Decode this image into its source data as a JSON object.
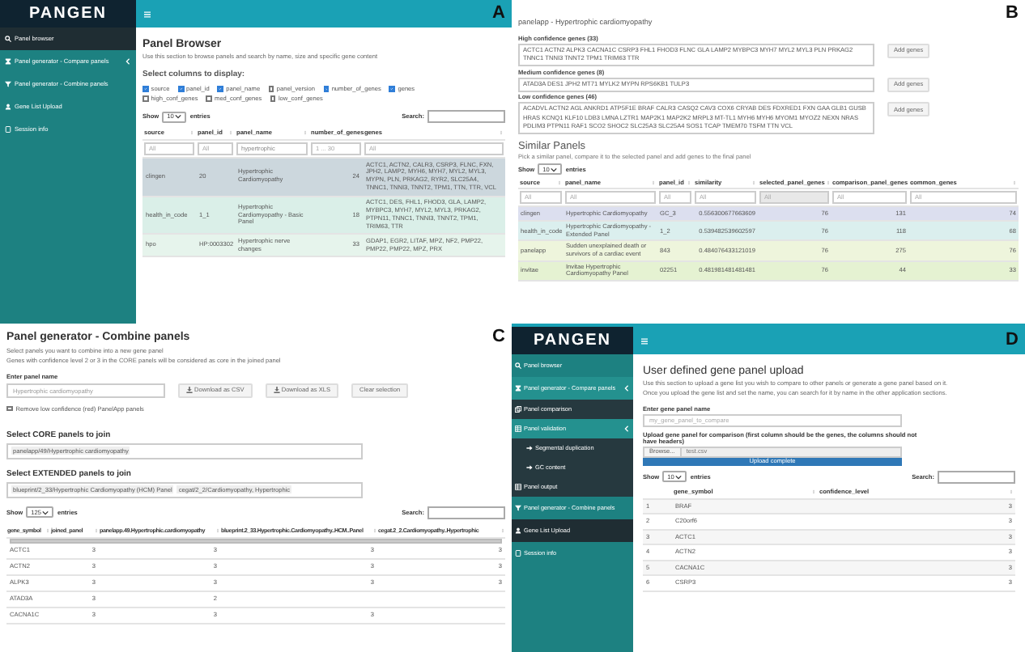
{
  "panel_a": {
    "label": "A",
    "logo": "PANGEN",
    "sidebar": {
      "items": [
        {
          "label": "Panel browser",
          "selected": true
        },
        {
          "label": "Panel generator - Compare panels",
          "selected": false,
          "expanded": false
        },
        {
          "label": "Panel generator - Combine panels",
          "selected": false
        },
        {
          "label": "Gene List Upload",
          "selected": false
        },
        {
          "label": "Session info",
          "selected": false
        }
      ]
    },
    "title": "Panel Browser",
    "description": "Use this section to browse panels and search by name, size and specific gene content",
    "columns_heading": "Select columns to display:",
    "column_options": [
      {
        "label": "source",
        "checked": true
      },
      {
        "label": "panel_id",
        "checked": true
      },
      {
        "label": "panel_name",
        "checked": true
      },
      {
        "label": "panel_version",
        "checked": false
      },
      {
        "label": "number_of_genes",
        "checked": true
      },
      {
        "label": "genes",
        "checked": true
      },
      {
        "label": "high_conf_genes",
        "checked": false
      },
      {
        "label": "med_conf_genes",
        "checked": false
      },
      {
        "label": "low_conf_genes",
        "checked": false
      }
    ],
    "show_label": "Show",
    "entries_select": "10",
    "entries_label": "entries",
    "search_label": "Search:",
    "table": {
      "columns": [
        "source",
        "panel_id",
        "panel_name",
        "number_of_genes",
        "genes"
      ],
      "filters": [
        {
          "placeholder": "All"
        },
        {
          "placeholder": "All"
        },
        {
          "value": "hypertrophic"
        },
        {
          "placeholder": "1 ... 30"
        },
        {
          "placeholder": "All"
        }
      ],
      "rows": [
        {
          "color": "#ccd7dd",
          "cells": [
            "clingen",
            "20",
            "Hypertrophic Cardiomyopathy",
            "24",
            "ACTC1, ACTN2, CALR3, CSRP3, FLNC, FXN, JPH2, LAMP2, MYH6, MYH7, MYL2, MYL3, MYPN, PLN, PRKAG2, RYR2, SLC25A4, TNNC1, TNNI3, TNNT2, TPM1, TTN, TTR, VCL"
          ]
        },
        {
          "color": "#daefe8",
          "cells": [
            "health_in_code",
            "1_1",
            "Hypertrophic Cardiomyopathy - Basic Panel",
            "18",
            "ACTC1, DES, FHL1, FHOD3, GLA, LAMP2, MYBPC3, MYH7, MYL2, MYL3, PRKAG2, PTPN11, TNNC1, TNNI3, TNNT2, TPM1, TRIM63, TTR"
          ]
        },
        {
          "color": "#e6f4ec",
          "cells": [
            "hpo",
            "HP:0003302",
            "Hypertrophic nerve changes",
            "33",
            "GDAP1, EGR2, LITAF, MPZ, NF2, PMP22, PMP22, PMP22, MPZ, PRX"
          ]
        }
      ]
    }
  },
  "panel_b": {
    "label": "B",
    "panel_title": "panelapp - Hypertrophic cardiomyopathy",
    "gene_groups": [
      {
        "heading": "High confidence genes (33)",
        "genes": "ACTC1 ACTN2 ALPK3 CACNA1C CSRP3 FHL1 FHOD3 FLNC GLA LAMP2 MYBPC3 MYH7 MYL2 MYL3 PLN PRKAG2 TNNC1 TNNI3 TNNT2 TPM1 TRIM63 TTR",
        "button": "Add genes"
      },
      {
        "heading": "Medium confidence genes (8)",
        "genes": "ATAD3A DES1 JPH2 MT71 MYLK2 MYPN RPS6KB1 TULP3",
        "button": "Add genes"
      },
      {
        "heading": "Low confidence genes (46)",
        "genes": "ACADVL ACTN2 AGL ANKRD1 ATP5F1E BRAF CALR3 CASQ2 CAV3 COX6 CRYAB DES FDXRED1 FXN GAA GLB1 GUSB HRAS KCNQ1 KLF10 LDB3 LMNA LZTR1 MAP2K1 MAP2K2 MRPL3 MT-TL1 MYH6 MYH6 MYOM1 MYOZ2 NEXN NRAS PDLIM3 PTPN11 RAF1 SCO2 SHOC2 SLC25A3 SLC25A4 SOS1 TCAP TMEM70 TSFM TTN VCL",
        "button": "Add genes"
      }
    ],
    "similar_title": "Similar Panels",
    "similar_description": "Pick a similar panel, compare it to the selected panel and add genes to the final panel",
    "show_label": "Show",
    "entries_select": "10",
    "entries_label": "entries",
    "table": {
      "columns": [
        "source",
        "panel_name",
        "panel_id",
        "similarity",
        "selected_panel_genes",
        "comparison_panel_genes",
        "common_genes"
      ],
      "filters": [
        {
          "placeholder": "All",
          "disabled": false
        },
        {
          "placeholder": "All",
          "disabled": false
        },
        {
          "placeholder": "All",
          "disabled": false
        },
        {
          "placeholder": "All",
          "disabled": false
        },
        {
          "placeholder": "All",
          "disabled": true
        },
        {
          "placeholder": "All",
          "disabled": false
        },
        {
          "placeholder": "All",
          "disabled": false
        }
      ],
      "rows": [
        {
          "color": "#dcdfef",
          "cells": [
            "clingen",
            "Hypertrophic Cardiomyopathy",
            "GC_3",
            "0.556300677663609",
            "76",
            "131",
            "74"
          ]
        },
        {
          "color": "#dbefee",
          "cells": [
            "health_in_code",
            "Hypertrophic Cardiomyopathy - Extended Panel",
            "1_2",
            "0.539482539602597",
            "76",
            "118",
            "68"
          ]
        },
        {
          "color": "#eef5dc",
          "cells": [
            "panelapp",
            "Sudden unexplained death or survivors of a cardiac event",
            "843",
            "0.484076433121019",
            "76",
            "275",
            "76"
          ]
        },
        {
          "color": "#e5f2d2",
          "cells": [
            "invitae",
            "Invitae Hypertrophic Cardiomyopathy Panel",
            "02251",
            "0.481981481481481",
            "76",
            "44",
            "33"
          ]
        }
      ]
    }
  },
  "panel_c": {
    "label": "C",
    "title": "Panel generator - Combine panels",
    "descriptions": [
      "Select panels you want to combine into a new gene panel",
      "Genes with confidence level 2 or 3 in the CORE panels will be considered as core in the joined panel"
    ],
    "name_label": "Enter panel name",
    "name_field": {
      "value": "Hypertrophic cardiomyopathy"
    },
    "buttons": [
      {
        "label": "Download as CSV",
        "kind": "download"
      },
      {
        "label": "Download as XLS",
        "kind": "download"
      },
      {
        "label": "Clear selection",
        "kind": "plain"
      }
    ],
    "remove_low": {
      "label": "Remove low confidence (red) PanelApp panels",
      "checked": false
    },
    "core_heading": "Select CORE panels to join",
    "core_panels": [
      "panelapp/49/Hypertrophic cardiomyopathy"
    ],
    "extended_heading": "Select EXTENDED panels to join",
    "extended_panels": [
      "blueprint/2_33/Hypertrophic Cardiomyopathy (HCM) Panel",
      "cegat/2_2/Cardiomyopathy, Hypertrophic"
    ],
    "show_label": "Show",
    "entries_select": "125",
    "entries_label": "entries",
    "search_label": "Search:",
    "table": {
      "columns": [
        "gene_symbol",
        "joined_panel",
        "panelapp.49.Hypertrophic.cardiomyopathy",
        "blueprint.2_33.Hypertrophic.Cardiomyopathy..HCM..Panel",
        "cegat.2_2.Cardiomyopathy..Hypertrophic"
      ],
      "rows": [
        [
          "ACTC1",
          "3",
          "3",
          "3",
          "3"
        ],
        [
          "ACTN2",
          "3",
          "3",
          "3",
          "3"
        ],
        [
          "ALPK3",
          "3",
          "3",
          "3",
          "3"
        ],
        [
          "ATAD3A",
          "3",
          "2",
          null,
          null
        ],
        [
          "CACNA1C",
          "3",
          "3",
          "3",
          null
        ]
      ]
    }
  },
  "panel_d": {
    "label": "D",
    "logo": "PANGEN",
    "sidebar": {
      "items": [
        {
          "label": "Panel browser",
          "selected": false
        },
        {
          "label": "Panel generator - Compare panels",
          "selected": false,
          "expanded": true,
          "children": [
            {
              "label": "Panel comparison",
              "selected": false
            },
            {
              "label": "Panel validation",
              "selected": false,
              "expanded": true,
              "children": [
                {
                  "label": "Segmental duplication",
                  "selected": false
                },
                {
                  "label": "GC content",
                  "selected": false
                }
              ]
            },
            {
              "label": "Panel output",
              "selected": false
            }
          ]
        },
        {
          "label": "Panel generator - Combine panels",
          "selected": false
        },
        {
          "label": "Gene List Upload",
          "selected": true
        },
        {
          "label": "Session info",
          "selected": false
        }
      ]
    },
    "title": "User defined gene panel upload",
    "descriptions": [
      "Use this section to upload a gene list you wish to compare to other panels or generate a gene panel based on it.",
      "Once you upload the gene list and set the name, you can search for it by name in the other application sections."
    ],
    "name_label": "Enter gene panel name",
    "name_field": {
      "placeholder": "my_gene_panel_to_compare"
    },
    "upload_label": "Upload gene panel for comparison (first column should be the genes, the columns should not have headers)",
    "browse_button": "Browse...",
    "file_name": "test.csv",
    "upload_progress": {
      "level": 1,
      "label": "Upload complete"
    },
    "show_label": "Show",
    "entries_select": "10",
    "entries_label": "entries",
    "search_label": "Search:",
    "table": {
      "columns": [
        "gene_symbol",
        "confidence_level"
      ],
      "rows": [
        {
          "index": "1",
          "cells": [
            "BRAF",
            "3"
          ]
        },
        {
          "index": "2",
          "cells": [
            "C20orf6",
            "3"
          ]
        },
        {
          "index": "3",
          "cells": [
            "ACTC1",
            "3"
          ]
        },
        {
          "index": "4",
          "cells": [
            "ACTN2",
            "3"
          ]
        },
        {
          "index": "5",
          "cells": [
            "CACNA1C",
            "3"
          ]
        },
        {
          "index": "6",
          "cells": [
            "CSRP3",
            "3"
          ]
        }
      ]
    }
  }
}
